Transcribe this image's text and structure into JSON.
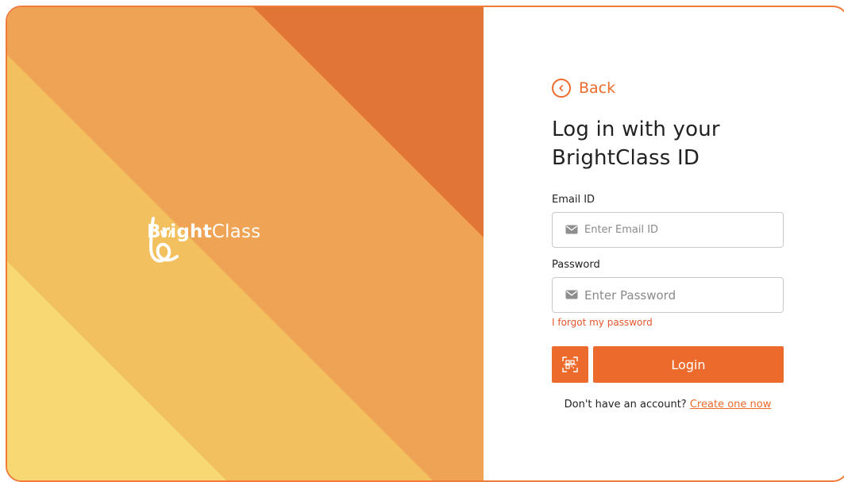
{
  "brand": {
    "name_bold": "Bright",
    "name_light": "Class",
    "logo_icon": "brightclass-logo-icon"
  },
  "colors": {
    "accent": "#EC6A2C",
    "stripe_darkest": "#E07535",
    "stripe_dark": "#EEA454",
    "stripe_mid": "#F2C05F",
    "stripe_light": "#F8D872",
    "border": "#F07B3A"
  },
  "login": {
    "back_label": "Back",
    "back_icon": "chevron-left-circle-icon",
    "title_line1": "Log in with your",
    "title_line2": "BrightClass ID",
    "email_label": "Email ID",
    "email_placeholder": "Enter Email ID",
    "email_value": "",
    "email_icon": "envelope-icon",
    "password_label": "Password",
    "password_placeholder": "Enter Password",
    "password_value": "",
    "password_icon": "envelope-icon",
    "forgot_label": "I forgot my password",
    "qr_icon": "qr-scan-icon",
    "login_label": "Login",
    "signup_prompt": "Don't have an account?",
    "signup_link": "Create one now"
  }
}
